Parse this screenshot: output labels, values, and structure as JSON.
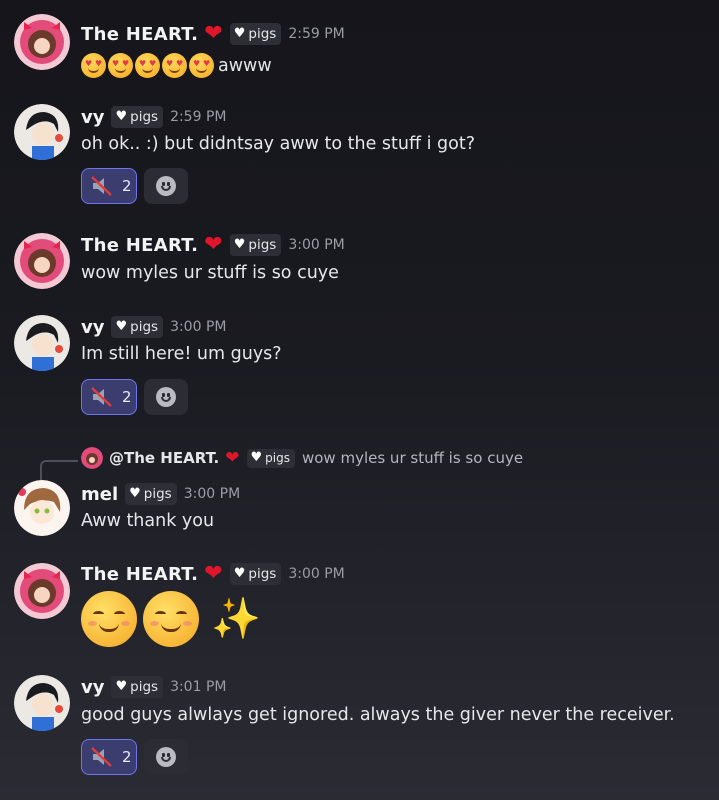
{
  "messages": [
    {
      "user": "The HEART.",
      "heart": "❤",
      "tag": "pigs",
      "time": "2:59 PM",
      "text": "awww"
    },
    {
      "user": "vy",
      "tag": "pigs",
      "time": "2:59 PM",
      "text": "oh ok.. :) but didntsay aww to the stuff i got?",
      "reaction_count": "2"
    },
    {
      "user": "The HEART.",
      "heart": "❤",
      "tag": "pigs",
      "time": "3:00 PM",
      "text": "wow myles ur stuff is so cuye"
    },
    {
      "user": "vy",
      "tag": "pigs",
      "time": "3:00 PM",
      "text": "Im still here! um guys?",
      "reaction_count": "2"
    },
    {
      "user": "mel",
      "tag": "pigs",
      "time": "3:00 PM",
      "text": "Aww thank you",
      "reply": {
        "user": "@The HEART.",
        "heart": "❤",
        "tag": "pigs",
        "text": "wow myles ur stuff is so cuye"
      }
    },
    {
      "user": "The HEART.",
      "heart": "❤",
      "tag": "pigs",
      "time": "3:00 PM",
      "text": ""
    },
    {
      "user": "vy",
      "tag": "pigs",
      "time": "3:01 PM",
      "text": "good guys alwlays get ignored. always the giver never the receiver.",
      "reaction_count": "2"
    }
  ],
  "icons": {
    "tag_heart": "♥",
    "sparkles": "✨"
  },
  "colors": {
    "accent_border": "#6d74ee",
    "reaction_bg": "#3a3d6e",
    "heart": "#e0162b"
  }
}
